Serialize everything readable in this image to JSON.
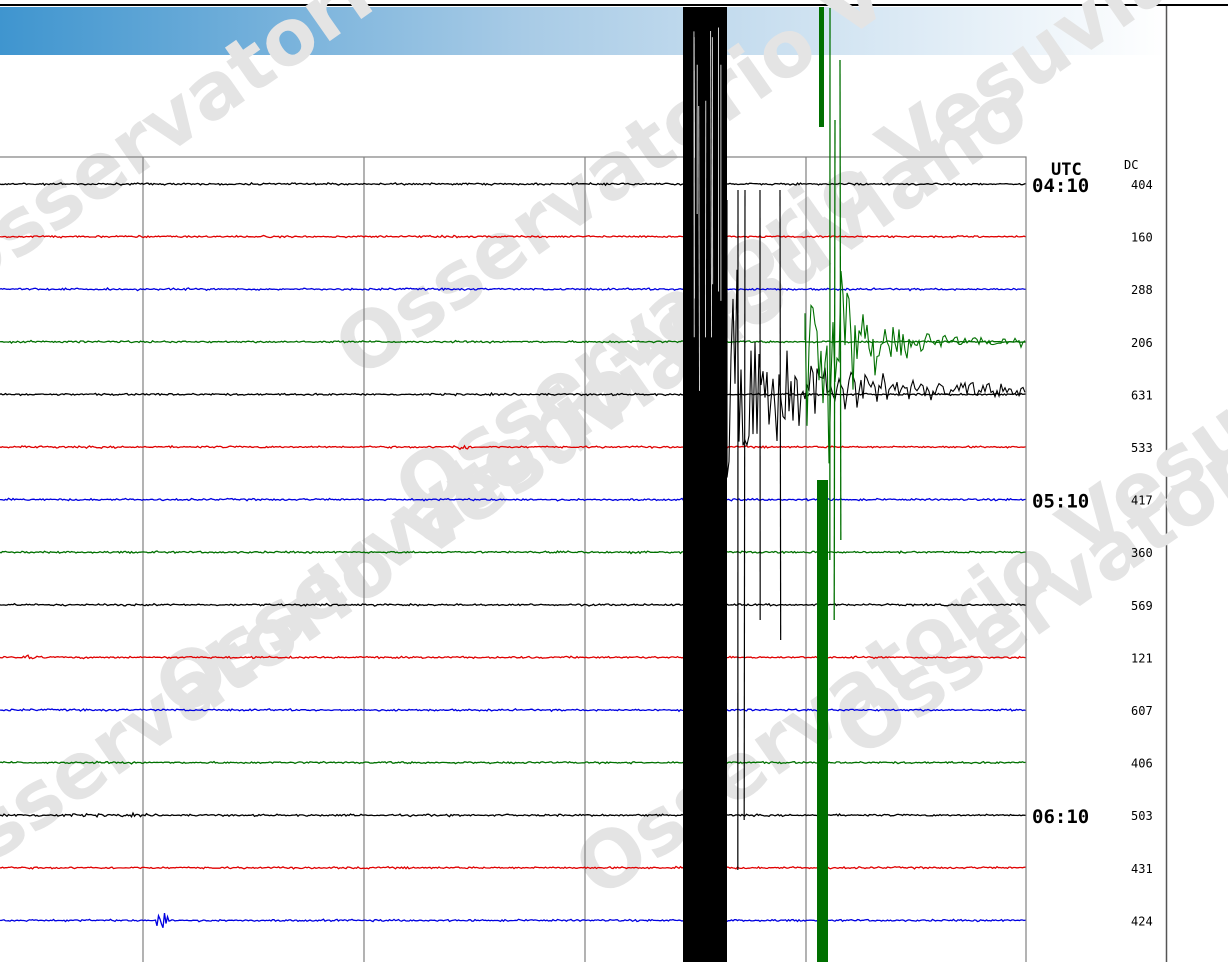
{
  "watermark": "Osservatorio Vesuviano",
  "header": {
    "utc_label": "UTC",
    "dc_label": "DC"
  },
  "colors": {
    "cycle": [
      "#000000",
      "#e00000",
      "#0000e0",
      "#007000"
    ],
    "header_gradient_start": "#4a9fd4",
    "header_gradient_end": "#ffffff",
    "grid": "#808080"
  },
  "chart_data": {
    "type": "line",
    "title": "",
    "xlabel": "",
    "ylabel": "",
    "traces": [
      {
        "index": 0,
        "color": "black",
        "dc": "404",
        "time_label": "04:10"
      },
      {
        "index": 1,
        "color": "red",
        "dc": "160",
        "time_label": ""
      },
      {
        "index": 2,
        "color": "blue",
        "dc": "288",
        "time_label": ""
      },
      {
        "index": 3,
        "color": "green",
        "dc": "206",
        "time_label": ""
      },
      {
        "index": 4,
        "color": "black",
        "dc": "631",
        "time_label": ""
      },
      {
        "index": 5,
        "color": "red",
        "dc": "533",
        "time_label": ""
      },
      {
        "index": 6,
        "color": "blue",
        "dc": "417",
        "time_label": "05:10"
      },
      {
        "index": 7,
        "color": "green",
        "dc": "360",
        "time_label": ""
      },
      {
        "index": 8,
        "color": "black",
        "dc": "569",
        "time_label": ""
      },
      {
        "index": 9,
        "color": "red",
        "dc": "121",
        "time_label": ""
      },
      {
        "index": 10,
        "color": "blue",
        "dc": "607",
        "time_label": ""
      },
      {
        "index": 11,
        "color": "green",
        "dc": "406",
        "time_label": ""
      },
      {
        "index": 12,
        "color": "black",
        "dc": "503",
        "time_label": "06:10"
      },
      {
        "index": 13,
        "color": "red",
        "dc": "431",
        "time_label": ""
      },
      {
        "index": 14,
        "color": "blue",
        "dc": "424",
        "time_label": ""
      }
    ]
  }
}
